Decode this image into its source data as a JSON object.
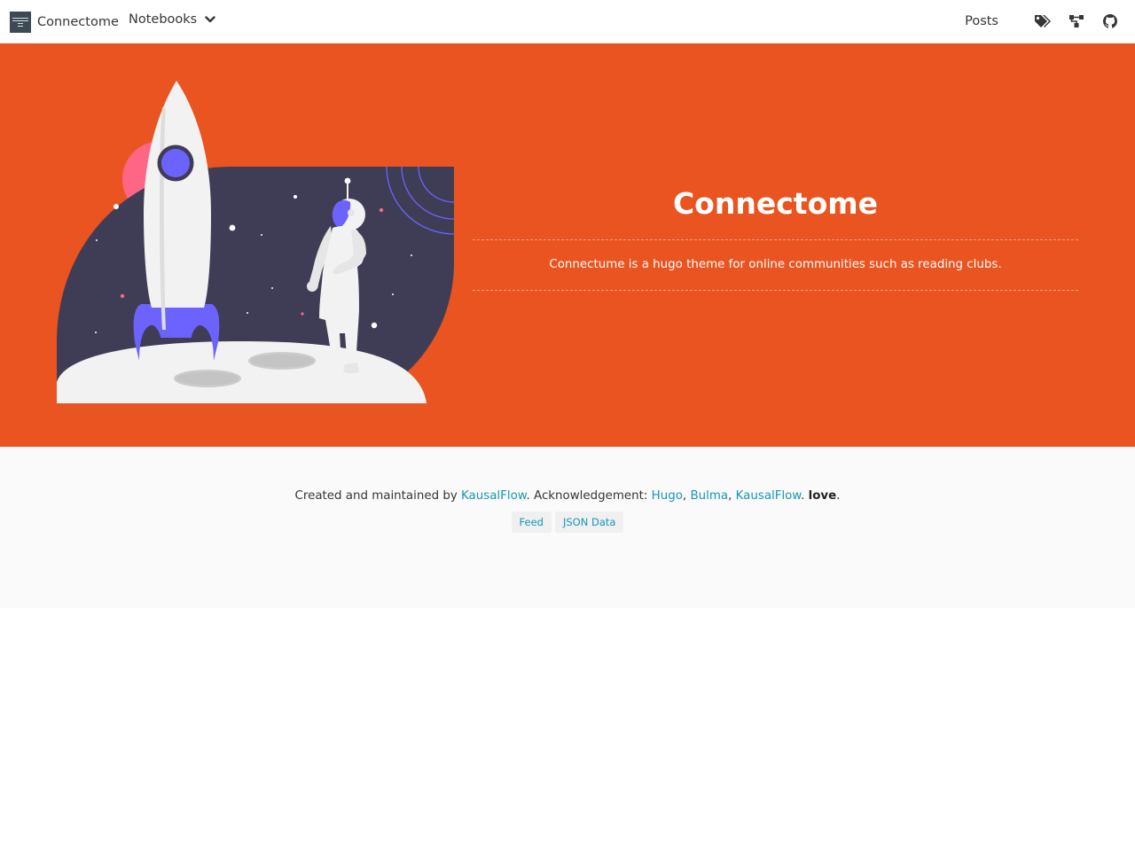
{
  "navbar": {
    "brand": "Connectome",
    "notebooks_label": "Notebooks",
    "posts_label": "Posts",
    "icons": [
      "tags-icon",
      "sitemap-icon",
      "github-icon"
    ]
  },
  "hero": {
    "title": "Connectome",
    "subtitle": "Connectume is a hugo theme for online communities such as reading clubs."
  },
  "footer": {
    "created_prefix": "Created and maintained by ",
    "creator_link": "KausalFlow",
    "ack_prefix": ". Acknowledgement: ",
    "ack_links": [
      "Hugo",
      "Bulma",
      "KausalFlow"
    ],
    "ack_sep": ", ",
    "love_sep": ". ",
    "love_word": "love",
    "end": ".",
    "tags": [
      "Feed",
      "JSON Data"
    ]
  },
  "colors": {
    "hero_bg": "#e95420",
    "link": "#1496bb",
    "footer_bg": "#fafafa",
    "accent_purple": "#6c63ff",
    "dark_navy": "#3f3d56"
  }
}
